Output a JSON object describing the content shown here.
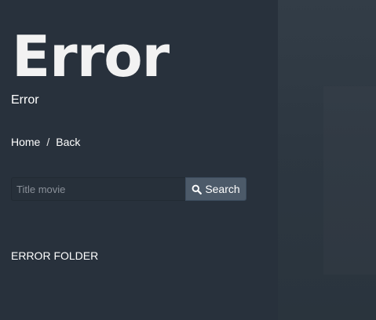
{
  "header": {
    "title": "Error",
    "subtitle": "Error"
  },
  "breadcrumb": {
    "home": "Home",
    "separator": "/",
    "back": "Back"
  },
  "search": {
    "placeholder": "Title movie",
    "value": "",
    "button_label": "Search",
    "icon": "search-icon"
  },
  "main": {
    "folder_label": "ERROR FOLDER"
  },
  "colors": {
    "background": "#28313c",
    "side_panel": "#313b45",
    "button": "#4c5a69",
    "text": "#ffffff"
  }
}
